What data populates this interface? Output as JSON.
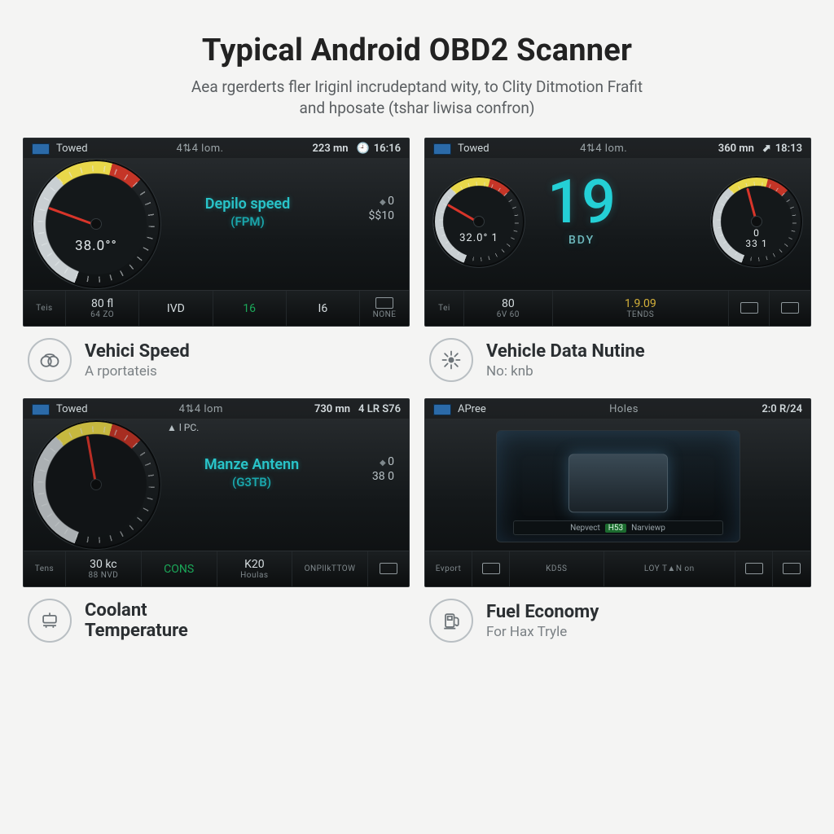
{
  "header": {
    "title": "Typical Android OBD2 Scanner",
    "subtitle_line1": "Aea rgerderts fler Iriginl incrudeptand wity, to Clity Ditmotion Frafit",
    "subtitle_line2": "and hposate (tshar liwisa confron)"
  },
  "panels": [
    {
      "status": {
        "brand": "Towed",
        "mid": "4⇅4 lom.",
        "dist": "223 mn",
        "clock": "16:16"
      },
      "gauge_main": {
        "readout": "38.0°°"
      },
      "center_label": {
        "line1": "Depilo speed",
        "line2": "(FPM)"
      },
      "side": {
        "v1": "0",
        "v2": "$$10"
      },
      "bottom": {
        "left_label": "Teis",
        "cells": [
          {
            "v": "80 fl",
            "s": "64  ZO"
          },
          {
            "v": "IVD",
            "s": ""
          },
          {
            "v": "16",
            "s": "",
            "accent": true
          },
          {
            "v": "I6",
            "s": ""
          },
          {
            "v": "",
            "s": "NONE",
            "icon": true
          }
        ]
      },
      "caption": {
        "title": "Vehici Speed",
        "sub": "A rportateis",
        "icon": "rings"
      }
    },
    {
      "status": {
        "brand": "Towed",
        "mid": "4⇅4 lom.",
        "dist": "360 mn",
        "clock": "18:13"
      },
      "gauge_main": {
        "readout": "32.0° 1"
      },
      "big": {
        "num": "19",
        "unit": "BDY"
      },
      "gauge_right": {
        "v1": "0",
        "v2": "33 1"
      },
      "bottom": {
        "left_label": "Tei",
        "cells": [
          {
            "v": "80",
            "s": "6V  60"
          },
          {
            "v": "1.9.09",
            "s": "TENDS",
            "warn": true,
            "wide": true
          },
          {
            "v": "",
            "s": "",
            "icon": true
          },
          {
            "v": "",
            "s": "",
            "icon": true
          }
        ]
      },
      "caption": {
        "title": "Vehicle Data Nutine",
        "sub": "No: knb",
        "icon": "burst"
      }
    },
    {
      "status": {
        "brand": "Towed",
        "mid": "4⇅4 lom",
        "dist": "730 mn",
        "clock": "4 LR S76"
      },
      "topnote": "▲ l PC.",
      "gauge_main": {
        "readout": ""
      },
      "center_label": {
        "line1": "Manze Antenn",
        "line2": "(G3TB)"
      },
      "side": {
        "v1": "0",
        "v2": "38 0"
      },
      "bottom": {
        "left_label": "Tens",
        "cells": [
          {
            "v": "30 kc",
            "s": "88  NVD"
          },
          {
            "v": "CONS",
            "s": "",
            "accent": true
          },
          {
            "v": "K20",
            "s": "Houlas"
          },
          {
            "v": "ONPllkTTOW",
            "s": ""
          },
          {
            "v": "",
            "s": "",
            "icon": true
          }
        ]
      },
      "caption": {
        "title": "Coolant",
        "title2": "Temperature",
        "sub": "",
        "icon": "thermo"
      }
    },
    {
      "status": {
        "brand": "APree",
        "mid": "Holes",
        "dist": "",
        "clock": "2:0 R/24"
      },
      "engine_strip": {
        "l": "Nepvect",
        "chip": "H53",
        "r": "Narviewp"
      },
      "bottom": {
        "left_label": "Evport",
        "cells": [
          {
            "v": "",
            "s": "",
            "icon": true
          },
          {
            "v": "KD5S",
            "s": ""
          },
          {
            "v": "LOY T▲N on",
            "s": ""
          },
          {
            "v": "",
            "s": "",
            "icon": true
          },
          {
            "v": "",
            "s": "",
            "icon": true
          }
        ]
      },
      "caption": {
        "title": "Fuel Economy",
        "sub": "For Hax  Tryle",
        "icon": "pump"
      }
    }
  ]
}
